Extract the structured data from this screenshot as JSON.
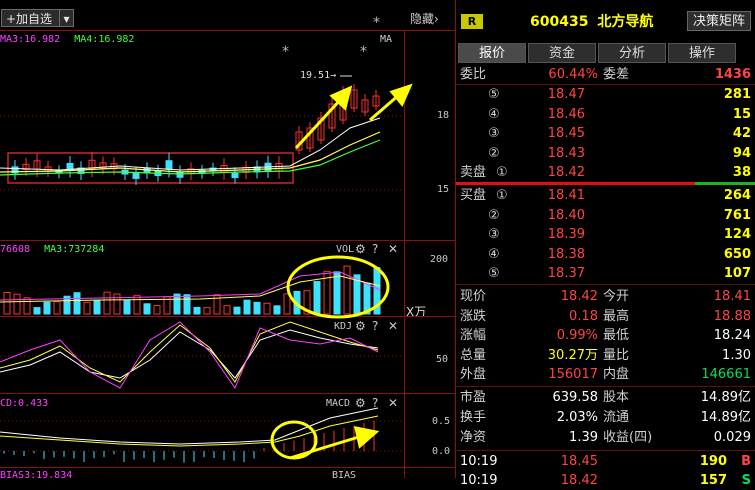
{
  "toolbar": {
    "add_watch": "+加自选",
    "hide": "隐藏›"
  },
  "main_chart": {
    "ma3_label": "MA3:16.982",
    "ma4_label": "MA4:16.982",
    "ma_tag": "MA",
    "star": "*",
    "peak_label": "19.51→",
    "axis": [
      "18",
      "15"
    ]
  },
  "vol_panel": {
    "value_label": "76608",
    "ma3_label": "MA3:737284",
    "name": "VOL",
    "axis_top": "200",
    "unit": "X万"
  },
  "kdj_panel": {
    "name": "KDJ",
    "axis": "50"
  },
  "macd_panel": {
    "value_label": "CD:0.433",
    "name": "MACD",
    "axis": [
      "0.5",
      "0.0"
    ]
  },
  "bias_panel": {
    "value_label": "BIAS3:19.834",
    "name": "BIAS"
  },
  "controls": {
    "gear": "⚙",
    "question": "?",
    "close": "✕"
  },
  "quote": {
    "badge": "R",
    "code": "600435",
    "name": "北方导航",
    "decision_btn": "决策矩阵",
    "tabs": [
      "报价",
      "资金",
      "分析",
      "操作"
    ],
    "weibi_label": "委比",
    "weibi_value": "60.44%",
    "weicha_label": "委差",
    "weicha_value": "1436",
    "sell_label": "卖盘",
    "buy_label": "买盘",
    "sells": [
      {
        "idx": "⑤",
        "price": "18.47",
        "vol": "281"
      },
      {
        "idx": "④",
        "price": "18.46",
        "vol": "15"
      },
      {
        "idx": "③",
        "price": "18.45",
        "vol": "42"
      },
      {
        "idx": "②",
        "price": "18.43",
        "vol": "94"
      },
      {
        "idx": "①",
        "price": "18.42",
        "vol": "38"
      }
    ],
    "buys": [
      {
        "idx": "①",
        "price": "18.41",
        "vol": "264"
      },
      {
        "idx": "②",
        "price": "18.40",
        "vol": "761"
      },
      {
        "idx": "③",
        "price": "18.39",
        "vol": "124"
      },
      {
        "idx": "④",
        "price": "18.38",
        "vol": "650"
      },
      {
        "idx": "⑤",
        "price": "18.37",
        "vol": "107"
      }
    ],
    "stats": [
      {
        "l1": "现价",
        "v1": "18.42",
        "c1": "red",
        "l2": "今开",
        "v2": "18.41",
        "c2": "red"
      },
      {
        "l1": "涨跌",
        "v1": "0.18",
        "c1": "red",
        "l2": "最高",
        "v2": "18.88",
        "c2": "red"
      },
      {
        "l1": "涨幅",
        "v1": "0.99%",
        "c1": "red",
        "l2": "最低",
        "v2": "18.24",
        "c2": "white"
      },
      {
        "l1": "总量",
        "v1": "30.27万",
        "c1": "yellow",
        "l2": "量比",
        "v2": "1.30",
        "c2": "white"
      },
      {
        "l1": "外盘",
        "v1": "156017",
        "c1": "red",
        "l2": "内盘",
        "v2": "146661",
        "c2": "green"
      }
    ],
    "stats2": [
      {
        "l1": "市盈",
        "v1": "639.58",
        "l2": "股本",
        "v2": "14.89亿"
      },
      {
        "l1": "换手",
        "v1": "2.03%",
        "l2": "流通",
        "v2": "14.89亿"
      },
      {
        "l1": "净资",
        "v1": "1.39",
        "l2": "收益(四)",
        "v2": "0.029"
      }
    ],
    "ticks": [
      {
        "time": "10:19",
        "price": "18.45",
        "vol": "190",
        "flag": "B"
      },
      {
        "time": "10:19",
        "price": "18.42",
        "vol": "157",
        "flag": "S"
      }
    ],
    "colors": {
      "up": "#ff4444",
      "down": "#00e060",
      "vol": "#ffff00",
      "border": "#8a1010"
    }
  }
}
